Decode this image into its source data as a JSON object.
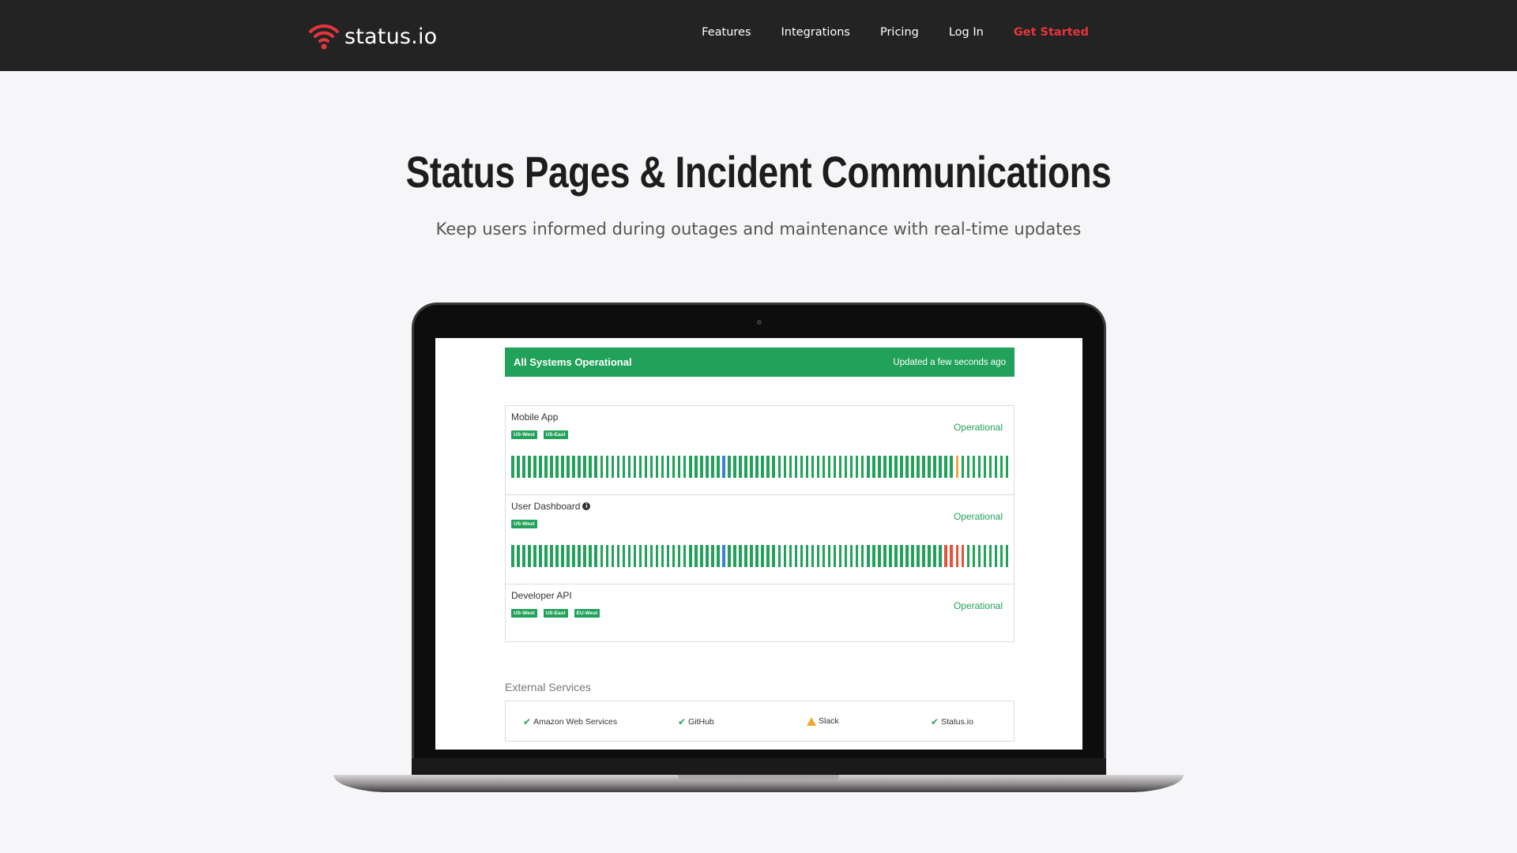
{
  "nav": {
    "logo_text": "status.io",
    "links": [
      "Features",
      "Integrations",
      "Pricing",
      "Log In"
    ],
    "cta": "Get Started"
  },
  "hero": {
    "title": "Status Pages & Incident Communications",
    "subtitle": "Keep users informed during outages and maintenance with real-time updates"
  },
  "status_page": {
    "banner": {
      "title": "All Systems Operational",
      "updated": "Updated a few seconds ago"
    },
    "components": [
      {
        "name": "Mobile App",
        "status": "Operational",
        "tags": [
          "US-West",
          "US-East"
        ],
        "uptime_bars": {
          "count": 90,
          "blue": [
            38
          ],
          "orange": [
            80
          ],
          "red": []
        }
      },
      {
        "name": "User Dashboard",
        "status": "Operational",
        "tags": [
          "US-West"
        ],
        "info_icon": "info-icon",
        "uptime_bars": {
          "count": 90,
          "blue": [
            38
          ],
          "orange": [],
          "red": [
            78,
            79,
            80,
            81
          ]
        }
      },
      {
        "name": "Developer API",
        "status": "Operational",
        "tags": [
          "US-West",
          "US-East",
          "EU-West"
        ]
      }
    ],
    "external_services": {
      "title": "External Services",
      "items": [
        {
          "name": "Amazon Web Services",
          "icon": "check-icon"
        },
        {
          "name": "GitHub",
          "icon": "check-icon"
        },
        {
          "name": "Slack",
          "icon": "warning-icon"
        },
        {
          "name": "Status.io",
          "icon": "check-icon"
        }
      ]
    }
  },
  "colors": {
    "nav_bg": "#232323",
    "accent_red": "#e5353c",
    "operational_green": "#22a15a",
    "incident_blue": "#3b7fde",
    "incident_orange": "#f3a53d",
    "incident_red": "#e4533a"
  }
}
